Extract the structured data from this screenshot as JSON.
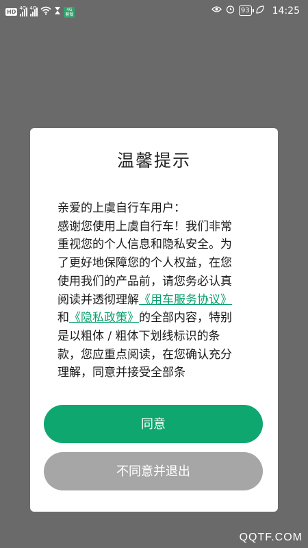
{
  "status_bar": {
    "hd_label": "HD",
    "signal_tags": [
      "4G",
      "4G"
    ],
    "data_badge": "4G\n套餐",
    "battery": "93",
    "time": "14:25"
  },
  "dialog": {
    "title": "温馨提示",
    "greeting": "亲爱的上虞自行车用户：",
    "body_part1": "感谢您使用上虞自行车！我们非常重视您的个人信息和隐私安全。为了更好地保障您的个人权益，在您使用我们的产品前，请您务必认真阅读并透彻理解",
    "link_service": "《用车服务协议》",
    "body_and": "和",
    "link_privacy": "《隐私政策》",
    "body_part2": "的全部内容，特别是以粗体 / 粗体下划线标识的条款，您应重点阅读，在您确认充分理解，同意并接受全部条",
    "agree_label": "同意",
    "disagree_label": "不同意并退出"
  },
  "watermark": "QQTF.COM",
  "colors": {
    "overlay": "#6a6a6a",
    "accent": "#0ea76f",
    "link": "#0aa06e",
    "disabled": "#a6a6a6"
  }
}
